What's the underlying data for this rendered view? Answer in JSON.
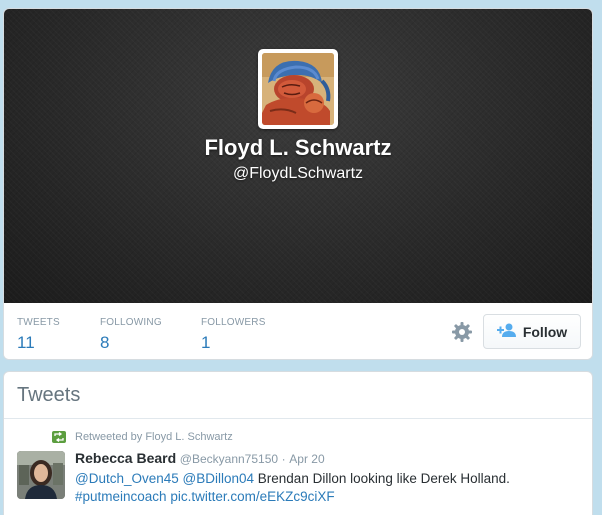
{
  "profile": {
    "name": "Floyd L. Schwartz",
    "handle": "@FloydLSchwartz"
  },
  "stats": [
    {
      "label": "TWEETS",
      "value": "11"
    },
    {
      "label": "FOLLOWING",
      "value": "8"
    },
    {
      "label": "FOLLOWERS",
      "value": "1"
    }
  ],
  "actions": {
    "follow_label": "Follow",
    "settings_icon": "gear-icon",
    "follow_icon": "add-user-icon"
  },
  "tweets_section": {
    "heading": "Tweets"
  },
  "tweet": {
    "retweet_label": "Retweeted by Floyd L. Schwartz",
    "author_name": "Rebecca Beard",
    "author_handle": "@Beckyann75150",
    "separator": "·",
    "date": "Apr 20",
    "mention1": "@Dutch_Oven45",
    "mention2": "@BDillon04",
    "text": " Brendan Dillon looking like Derek Holland.",
    "hashtag": "#putmeincoach",
    "pic_link": "pic.twitter.com/eEKZc9ciXF"
  },
  "colors": {
    "background": "#c0deed",
    "link": "#2b7bb9",
    "muted": "#8899a6",
    "retweet_green": "#5c9e3f"
  }
}
